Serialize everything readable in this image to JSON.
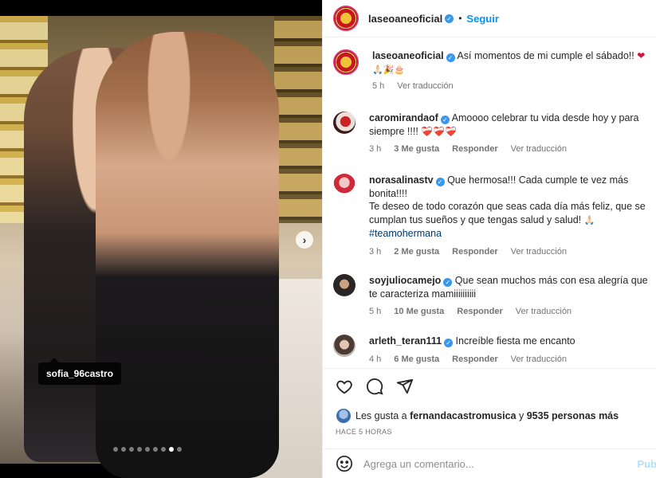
{
  "photo": {
    "tag_user": "sofia_96castro",
    "dots_count": 9,
    "active_dot": 7
  },
  "header": {
    "username": "laseoaneoficial",
    "follow": "Seguir"
  },
  "caption": {
    "username": "laseoaneoficial",
    "text": "Así momentos de mi cumple el sábado!!",
    "emoji": "🙏🏻🎉🎂",
    "time": "5 h",
    "translate": "Ver traducción"
  },
  "comments": [
    {
      "username": "caromirandaof",
      "text": "Amoooo celebrar tu vida desde hoy y para siempre !!!!",
      "emoji": "❤️‍🩹❤️‍🩹❤️‍🩹",
      "time": "3 h",
      "likes": "3 Me gusta",
      "reply": "Responder",
      "translate": "Ver traducción"
    },
    {
      "username": "norasalinastv",
      "text": "Que hermosa!!! Cada cumple te vez más bonita!!!!",
      "text2": "Te deseo de todo corazón que seas cada día más feliz, que se cumplan tus sueños y que tengas salud y salud!",
      "emoji": "🙏🏻",
      "hashtag": "#teamohermana",
      "time": "3 h",
      "likes": "2 Me gusta",
      "reply": "Responder",
      "translate": "Ver traducción"
    },
    {
      "username": "soyjuliocamejo",
      "text": "Que sean muchos más con esa alegría que te caracteriza mamiiiiiiiiii",
      "time": "5 h",
      "likes": "10 Me gusta",
      "reply": "Responder",
      "translate": "Ver traducción"
    },
    {
      "username": "arleth_teran111",
      "text": "Increíble fiesta me encanto",
      "time": "4 h",
      "likes": "6 Me gusta",
      "reply": "Responder",
      "translate": "Ver traducción"
    }
  ],
  "likes_line": {
    "prefix": "Les gusta a",
    "user": "fernandacastromusica",
    "mid": "y",
    "count": "9535 personas más"
  },
  "posted": "HACE 5 HORAS",
  "add_comment": {
    "placeholder": "Agrega un comentario...",
    "publish": "Pub"
  }
}
